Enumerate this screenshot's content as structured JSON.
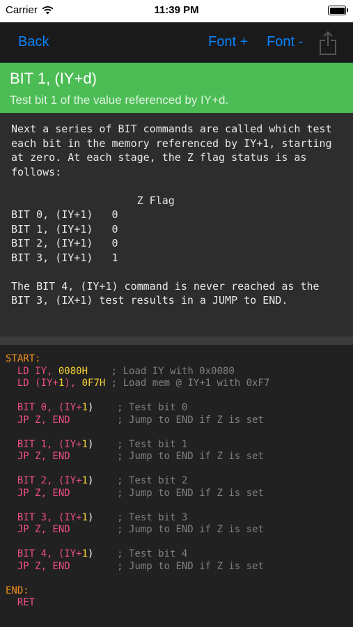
{
  "status_bar": {
    "carrier": "Carrier",
    "time": "11:39 PM",
    "wifi_icon": "wifi-icon",
    "battery_icon": "battery-icon"
  },
  "nav": {
    "back": "Back",
    "font_plus": "Font +",
    "font_minus": "Font -",
    "share_icon": "share-icon"
  },
  "header": {
    "title": "BIT 1, (IY+d)",
    "subtitle": "Test bit 1 of the value referenced by IY+d."
  },
  "description": {
    "para1": "Next a series of BIT commands are called which test each bit in the memory referenced by IY+1, starting at zero. At each stage, the Z flag status is as follows:",
    "table": {
      "header": "Z Flag",
      "rows": [
        {
          "cmd": "BIT 0, (IY+1)",
          "flag": "0"
        },
        {
          "cmd": "BIT 1, (IY+1)",
          "flag": "0"
        },
        {
          "cmd": "BIT 2, (IY+1)",
          "flag": "0"
        },
        {
          "cmd": "BIT 3, (IY+1)",
          "flag": "1"
        }
      ]
    },
    "para2": "The BIT 4, (IY+1) command is never reached as the BIT 3, (IX+1) test results in a JUMP to END."
  },
  "code": {
    "label_start": "START:",
    "ld1_mn": "LD IY,",
    "ld1_val": "0080H",
    "ld1_cm": "; Load IY with 0x0080",
    "ld2_a": "LD (IY+",
    "ld2_b": "1",
    "ld2_c": "),",
    "ld2_val": "0F7H",
    "ld2_cm": "; Load mem @ IY+1 with 0xF7",
    "blocks": [
      {
        "bit": "BIT 0, (IY+",
        "idx": "1",
        "close": ")",
        "cm1": "; Test bit 0",
        "jp": "JP Z, END",
        "cm2": "; Jump to END if Z is set"
      },
      {
        "bit": "BIT 1, (IY+",
        "idx": "1",
        "close": ")",
        "cm1": "; Test bit 1",
        "jp": "JP Z, END",
        "cm2": "; Jump to END if Z is set"
      },
      {
        "bit": "BIT 2, (IY+",
        "idx": "1",
        "close": ")",
        "cm1": "; Test bit 2",
        "jp": "JP Z, END",
        "cm2": "; Jump to END if Z is set"
      },
      {
        "bit": "BIT 3, (IY+",
        "idx": "1",
        "close": ")",
        "cm1": "; Test bit 3",
        "jp": "JP Z, END",
        "cm2": "; Jump to END if Z is set"
      },
      {
        "bit": "BIT 4, (IY+",
        "idx": "1",
        "close": ")",
        "cm1": "; Test bit 4",
        "jp": "JP Z, END",
        "cm2": "; Jump to END if Z is set"
      }
    ],
    "label_end": "END:",
    "ret": "RET"
  },
  "colors": {
    "accent": "#0a84ff",
    "header_green": "#4cbc55",
    "label": "#f0901c",
    "keyword": "#ef4e86",
    "number": "#f6d33a",
    "comment": "#808080"
  }
}
